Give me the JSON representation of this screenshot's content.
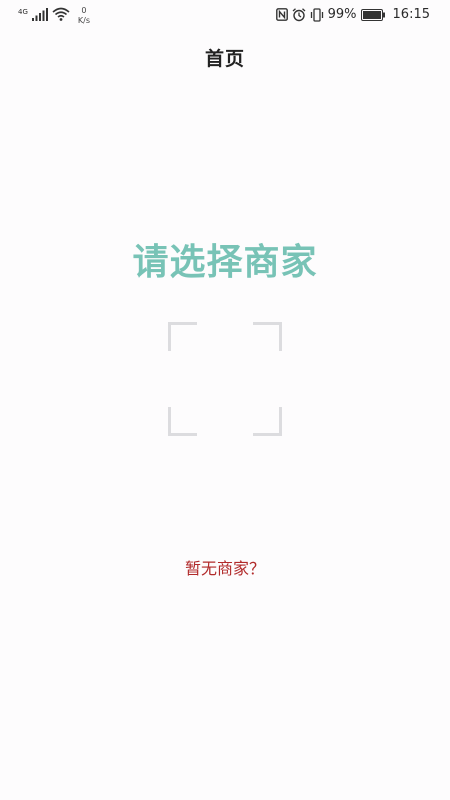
{
  "status_bar": {
    "network_type": "4G",
    "speed_value": "0",
    "speed_unit": "K/s",
    "battery_percent": "99%",
    "time": "16:15",
    "icons": [
      "signal-icon",
      "wifi-icon",
      "nfc-icon",
      "alarm-icon",
      "vibrate-icon",
      "battery-icon"
    ]
  },
  "header": {
    "title": "首页"
  },
  "main": {
    "prompt": "请选择商家",
    "scan_frame_icon": "scan-frame-icon",
    "no_merchant_link": "暂无商家？"
  },
  "colors": {
    "prompt": "#78c3b6",
    "link": "#b12a2a",
    "background": "#fdfcfd",
    "frame": "#dcdcdf"
  }
}
